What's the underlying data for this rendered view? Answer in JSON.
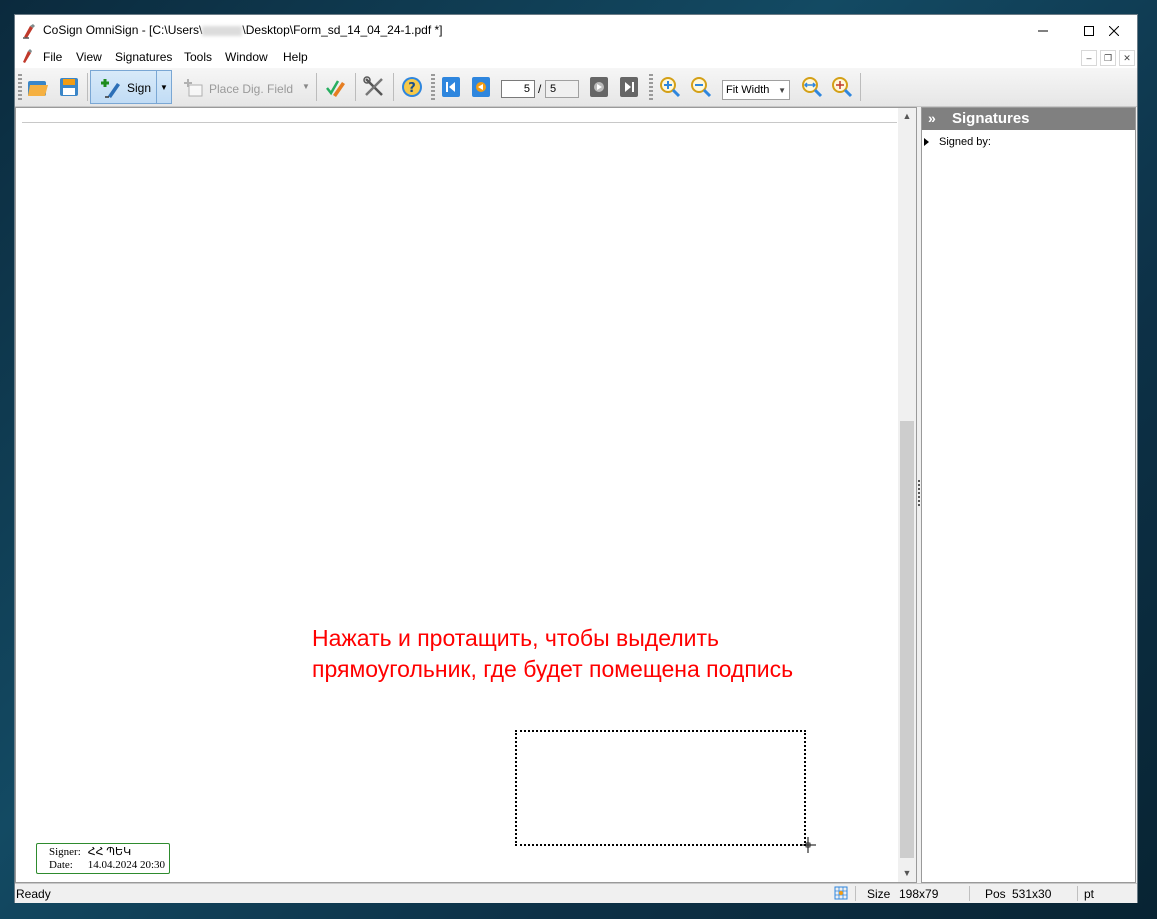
{
  "window": {
    "title_prefix": "CoSign OmniSign - [C:\\Users\\",
    "title_suffix": "\\Desktop\\Form_sd_14_04_24-1.pdf *]"
  },
  "menu": {
    "items": [
      "File",
      "View",
      "Signatures",
      "Tools",
      "Window",
      "Help"
    ]
  },
  "toolbar": {
    "sign_label": "Sign",
    "place_field_label": "Place Dig. Field",
    "current_page": "5",
    "page_separator": "/",
    "total_pages": "5",
    "zoom_mode": "Fit Width"
  },
  "document": {
    "hint_text": "Нажать и протащить, чтобы выделить\nпрямоугольник, где будет помещена подпись",
    "stamp": {
      "signer_label": "Signer:",
      "signer_value": "ՀՀ ՊԵԿ",
      "date_label": "Date:",
      "date_value": "14.04.2024 20:30"
    }
  },
  "signatures_panel": {
    "title": "Signatures",
    "tree_item": "Signed by:"
  },
  "statusbar": {
    "status": "Ready",
    "size_label": "Size",
    "size_value": "198x79",
    "pos_label": "Pos",
    "pos_value": "531x30",
    "unit": "pt"
  },
  "colors": {
    "hint_text": "#ff0000",
    "stamp_border": "#2e8b2e",
    "panel_header": "#808080"
  },
  "icons": [
    "app-icon",
    "open-file-icon",
    "save-icon",
    "sign-icon",
    "place-field-icon",
    "verify-icon",
    "tools-icon",
    "help-icon",
    "first-page-icon",
    "prev-page-icon",
    "next-page-icon",
    "last-page-icon",
    "zoom-in-icon",
    "zoom-out-icon",
    "zoom-fit-width-icon",
    "zoom-custom-icon"
  ]
}
